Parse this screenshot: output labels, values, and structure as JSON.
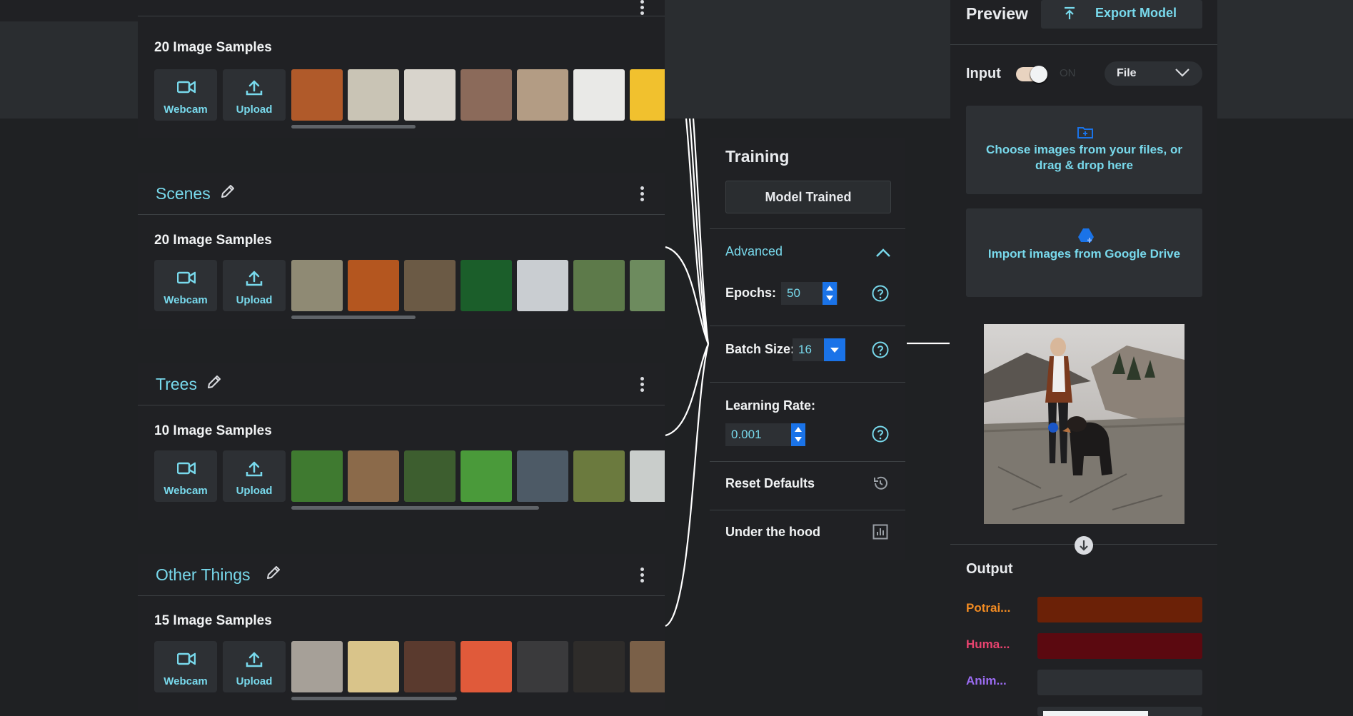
{
  "colors": {
    "accent": "#78d9ec",
    "output_class1": "#f28b22",
    "output_class2": "#e8436f",
    "output_class3": "#9b6cf2",
    "bar_class1": "#6b2107",
    "bar_class2": "#5b0910"
  },
  "classes": [
    {
      "name": "",
      "samples_label": "20 Image Samples",
      "webcam_label": "Webcam",
      "upload_label": "Upload",
      "thumbs": [
        "#b05a2a",
        "#c9c4b5",
        "#d8d4cc",
        "#8b6a5a",
        "#b39c84",
        "#e9e9e7",
        "#f1c12e"
      ]
    },
    {
      "name": "Scenes",
      "samples_label": "20 Image Samples",
      "webcam_label": "Webcam",
      "upload_label": "Upload",
      "thumbs": [
        "#8f8a74",
        "#b4561f",
        "#6b5a45",
        "#1b5e2a",
        "#c9cdd1",
        "#5d7a4a",
        "#6d8b5e"
      ]
    },
    {
      "name": "Trees",
      "samples_label": "10 Image Samples",
      "webcam_label": "Webcam",
      "upload_label": "Upload",
      "thumbs": [
        "#3f7a30",
        "#8b6a4a",
        "#3d5e2f",
        "#4a9a3a",
        "#4d5a66",
        "#6b7a3e",
        "#c9cdcb"
      ]
    },
    {
      "name": "Other Things",
      "samples_label": "15 Image Samples",
      "webcam_label": "Webcam",
      "upload_label": "Upload",
      "thumbs": [
        "#a6a098",
        "#d9c48a",
        "#5a3a2e",
        "#e05a3a",
        "#3a3a3c",
        "#2e2c2a",
        "#7a6048"
      ]
    }
  ],
  "training": {
    "title": "Training",
    "status_button": "Model Trained",
    "advanced_label": "Advanced",
    "epochs_label": "Epochs:",
    "epochs_value": "50",
    "batch_label": "Batch Size:",
    "batch_value": "16",
    "lr_label": "Learning Rate:",
    "lr_value": "0.001",
    "reset_label": "Reset Defaults",
    "hood_label": "Under the hood"
  },
  "preview": {
    "title": "Preview",
    "export_label": "Export Model",
    "input_label": "Input",
    "toggle_state": "ON",
    "source_select": "File",
    "dropzone_files": "Choose images from your files, or drag & drop here",
    "dropzone_drive": "Import images from Google Drive",
    "output_title": "Output",
    "outputs": [
      {
        "label": "Potrai...",
        "confidence": 1.0
      },
      {
        "label": "Huma...",
        "confidence": 1.0
      },
      {
        "label": "Anim...",
        "confidence": 0.0
      }
    ]
  }
}
